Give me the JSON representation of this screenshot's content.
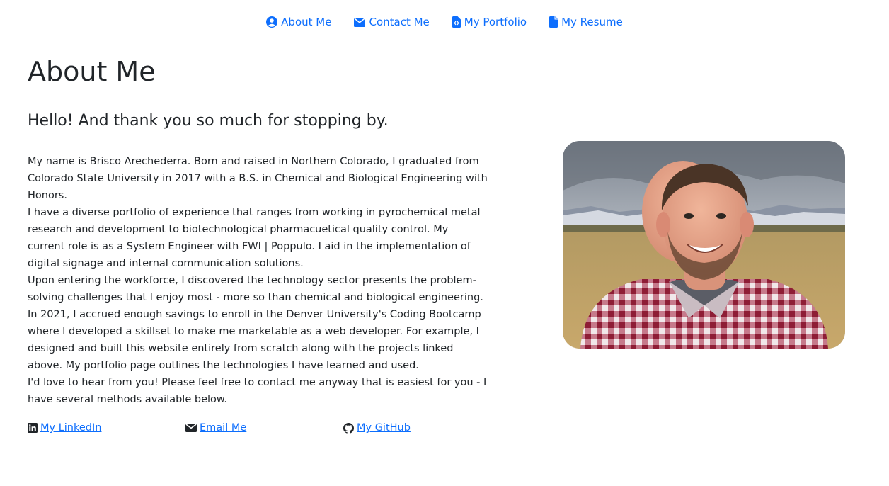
{
  "nav": {
    "items": [
      {
        "label": "About Me",
        "icon": "user-circle-icon"
      },
      {
        "label": "Contact Me",
        "icon": "envelope-icon"
      },
      {
        "label": "My Portfolio",
        "icon": "code-file-icon"
      },
      {
        "label": "My Resume",
        "icon": "file-icon"
      }
    ]
  },
  "main": {
    "title": "About Me",
    "subtitle": "Hello! And thank you so much for stopping by.",
    "paragraphs": [
      "My name is Brisco Arechederra. Born and raised in Northern Colorado, I graduated from Colorado State University in 2017 with a B.S. in Chemical and Biological Engineering with Honors.",
      "I have a diverse portfolio of experience that ranges from working in pyrochemical metal research and development to biotechnological pharmacuetical quality control. My current role is as a System Engineer with FWI | Poppulo. I aid in the implementation of digital signage and internal communication solutions.",
      "Upon entering the workforce, I discovered the technology sector presents the problem-solving challenges that I enjoy most - more so than chemical and biological engineering. In 2021, I accrued enough savings to enroll in the Denver University's Coding Bootcamp where I developed a skillset to make me marketable as a web developer. For example, I designed and built this website entirely from scratch along with the projects linked above. My portfolio page outlines the technologies I have learned and used.",
      "I'd love to hear from you! Please feel free to contact me anyway that is easiest for you - I have several methods available below."
    ],
    "links": [
      {
        "label": "My LinkedIn",
        "icon": "linkedin-icon"
      },
      {
        "label": "Email Me",
        "icon": "envelope-icon"
      },
      {
        "label": "My GitHub",
        "icon": "github-icon"
      }
    ]
  },
  "colors": {
    "link": "#0d6efd",
    "text": "#212529",
    "background": "#ffffff"
  }
}
